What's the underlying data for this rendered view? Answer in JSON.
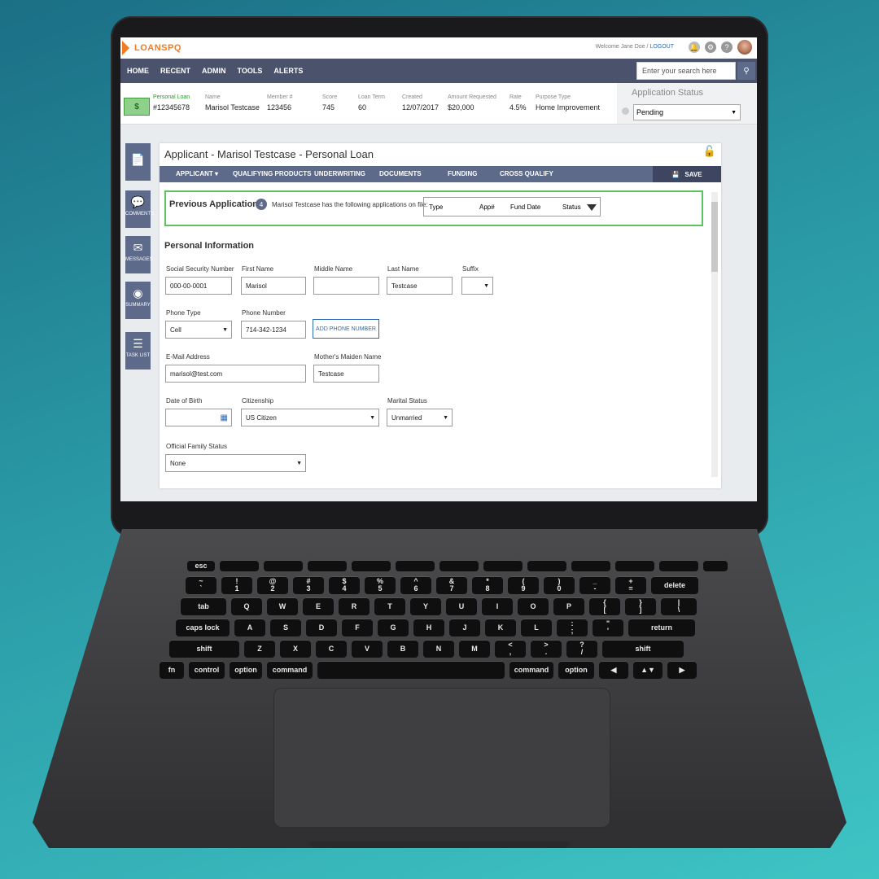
{
  "app": {
    "logo": "LOANSPQ",
    "welcome": "Welcome Jane Doe /",
    "logout": "LOGOUT"
  },
  "nav": {
    "items": [
      "HOME",
      "RECENT",
      "ADMIN",
      "TOOLS",
      "ALERTS"
    ],
    "search_placeholder": "Enter your search here"
  },
  "summary": {
    "loan_type": "Personal Loan",
    "loan_id": "#12345678",
    "fields": [
      {
        "label": "Name",
        "value": "Marisol Testcase"
      },
      {
        "label": "Member #",
        "value": "123456"
      },
      {
        "label": "Score",
        "value": "745"
      },
      {
        "label": "Loan Term",
        "value": "60"
      },
      {
        "label": "Created",
        "value": "12/07/2017"
      },
      {
        "label": "Amount Requested",
        "value": "$20,000"
      },
      {
        "label": "Rate",
        "value": "4.5%"
      },
      {
        "label": "Purpose Type",
        "value": "Home Improvement"
      }
    ],
    "status_title": "Application Status",
    "status_value": "Pending"
  },
  "sidebar": {
    "items": [
      {
        "label": "",
        "icon": "document-icon"
      },
      {
        "label": "COMMENTS",
        "icon": "comment-icon"
      },
      {
        "label": "MESSAGES",
        "icon": "envelope-icon"
      },
      {
        "label": "SUMMARY",
        "icon": "eye-icon"
      },
      {
        "label": "TASK LIST",
        "icon": "list-icon"
      }
    ]
  },
  "panel": {
    "title": "Applicant - Marisol Testcase - Personal Loan",
    "tabs": [
      "APPLICANT",
      "QUALIFYING PRODUCTS",
      "UNDERWRITING",
      "DOCUMENTS",
      "FUNDING",
      "CROSS QUALIFY"
    ],
    "save": "SAVE",
    "prev": {
      "heading": "Previous Applications",
      "count": "4",
      "desc": "Marisol Testcase has the following applications on file:",
      "cols": [
        "Type",
        "App#",
        "Fund Date",
        "Status"
      ]
    },
    "section": "Personal Information",
    "fields": {
      "ssn": {
        "label": "Social Security Number",
        "value": "000-00-0001"
      },
      "first": {
        "label": "First Name",
        "value": "Marisol"
      },
      "middle": {
        "label": "Middle Name",
        "value": ""
      },
      "last": {
        "label": "Last Name",
        "value": "Testcase"
      },
      "suffix": {
        "label": "Suffix",
        "value": ""
      },
      "phone_type": {
        "label": "Phone Type",
        "value": "Cell"
      },
      "phone": {
        "label": "Phone Number",
        "value": "714-342-1234"
      },
      "add_phone": "ADD PHONE NUMBER",
      "email": {
        "label": "E-Mail Address",
        "value": "marisol@test.com"
      },
      "maiden": {
        "label": "Mother's Maiden Name",
        "value": "Testcase"
      },
      "dob": {
        "label": "Date of Birth",
        "value": ""
      },
      "citizenship": {
        "label": "Citizenship",
        "value": "US Citizen"
      },
      "marital": {
        "label": "Marital Status",
        "value": "Unmarried"
      },
      "family": {
        "label": "Official Family Status",
        "value": "None"
      }
    }
  },
  "keyboard": {
    "row1": [
      "esc",
      "",
      "",
      "",
      "",
      "",
      "",
      "",
      "",
      "",
      "",
      "",
      ""
    ],
    "row2": [
      "~\n`",
      "!\n1",
      "@\n2",
      "#\n3",
      "$\n4",
      "%\n5",
      "^\n6",
      "&\n7",
      "*\n8",
      "(\n9",
      ")\n0",
      "_\n-",
      "+\n=",
      "delete"
    ],
    "row3": [
      "tab",
      "Q",
      "W",
      "E",
      "R",
      "T",
      "Y",
      "U",
      "I",
      "O",
      "P",
      "{\n[",
      "}\n]",
      "|\n\\"
    ],
    "row4": [
      "caps lock",
      "A",
      "S",
      "D",
      "F",
      "G",
      "H",
      "J",
      "K",
      "L",
      ":\n;",
      "\"\n'",
      "return"
    ],
    "row5": [
      "shift",
      "Z",
      "X",
      "C",
      "V",
      "B",
      "N",
      "M",
      "<\n,",
      ">\n.",
      "?\n/",
      "shift"
    ],
    "row6": [
      "fn",
      "control",
      "option",
      "command",
      "",
      "command",
      "option",
      "◀",
      "▲▼",
      "▶"
    ]
  }
}
